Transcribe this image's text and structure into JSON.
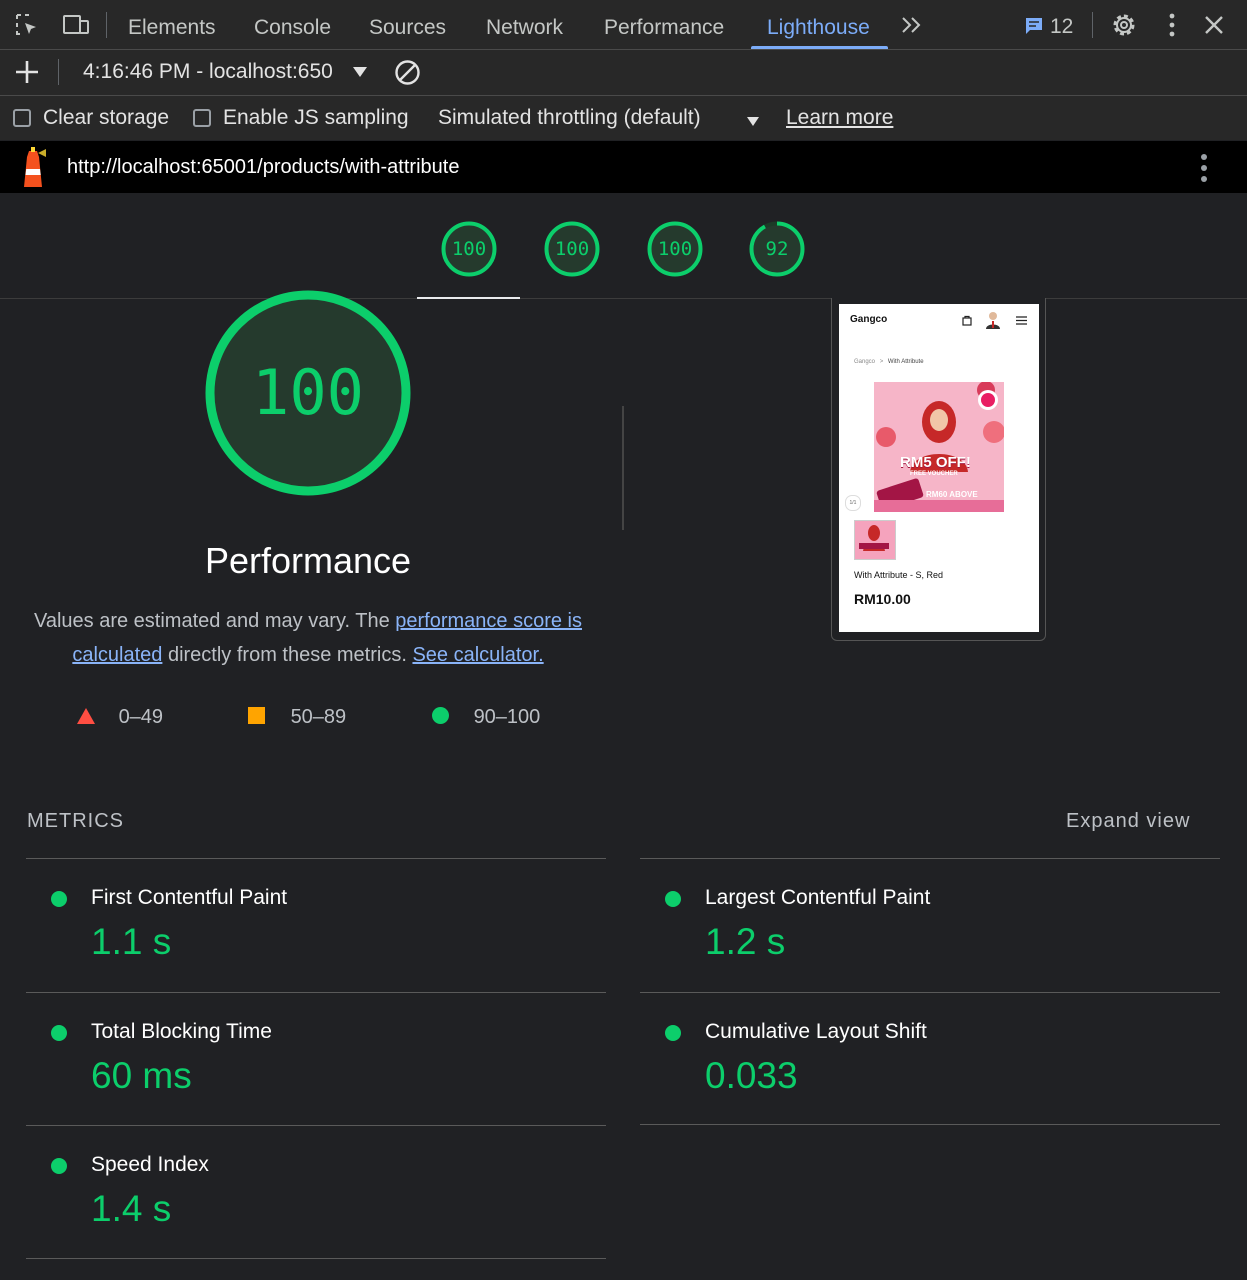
{
  "devtools": {
    "tabs": [
      "Elements",
      "Console",
      "Sources",
      "Network",
      "Performance",
      "Lighthouse"
    ],
    "active_tab": "Lighthouse",
    "issues_count": "12"
  },
  "toolbar": {
    "report_selector": "4:16:46 PM - localhost:650"
  },
  "settings": {
    "clear_storage_label": "Clear storage",
    "clear_storage_checked": false,
    "js_sampling_label": "Enable JS sampling",
    "js_sampling_checked": false,
    "throttling_value": "Simulated throttling (default)",
    "learn_more": "Learn more"
  },
  "report": {
    "url": "http://localhost:65001/products/with-attribute",
    "gauges": [
      {
        "score": "100"
      },
      {
        "score": "100"
      },
      {
        "score": "100"
      },
      {
        "score": "92"
      }
    ],
    "category": {
      "score": "100",
      "title": "Performance",
      "desc_prefix": "Values are estimated and may vary. The ",
      "desc_link1": "performance score is calculated",
      "desc_middle": " directly from these metrics. ",
      "desc_link2": "See calculator."
    },
    "legend": [
      "0–49",
      "50–89",
      "90–100"
    ],
    "colors": {
      "pass": "#0cce6b",
      "average": "#ffa400",
      "fail": "#ff4e42"
    }
  },
  "screenshot": {
    "brand": "Gangco",
    "crumb_home": "Gangco",
    "crumb_sep": ">",
    "crumb_current": "With Attribute",
    "promo": "RM5 OFF!",
    "promo_sub": "FREE VOUCHER",
    "promo_sub2": "RM60 ABOVE",
    "pager": "1/1",
    "product_name": "With Attribute - S, Red",
    "price": "RM10.00"
  },
  "metrics": {
    "heading": "METRICS",
    "expand_label": "Expand view",
    "items": [
      {
        "label": "First Contentful Paint",
        "value": "1.1 s"
      },
      {
        "label": "Largest Contentful Paint",
        "value": "1.2 s"
      },
      {
        "label": "Total Blocking Time",
        "value": "60 ms"
      },
      {
        "label": "Cumulative Layout Shift",
        "value": "0.033"
      },
      {
        "label": "Speed Index",
        "value": "1.4 s"
      }
    ]
  }
}
